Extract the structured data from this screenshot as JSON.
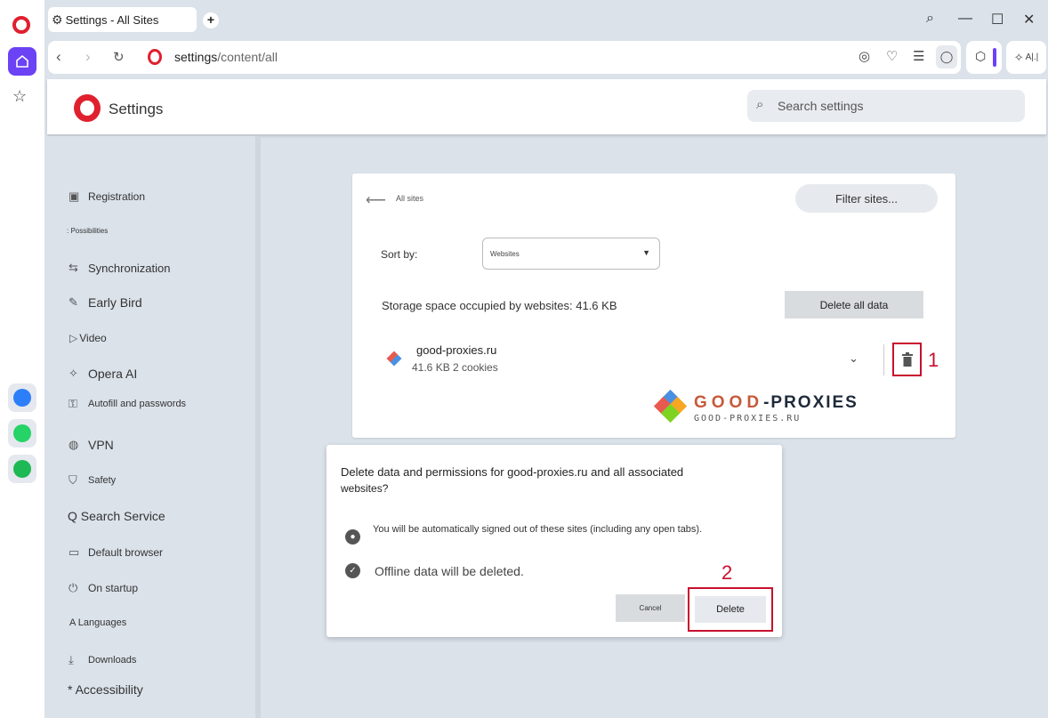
{
  "window": {
    "tab_title": "Settings - All Sites",
    "new_tab_label": "+",
    "controls": {
      "search_glyph": "⌕",
      "minimize_glyph": "—",
      "maximize_glyph": "☐",
      "close_glyph": "✕"
    }
  },
  "address_bar": {
    "url_host": "settings",
    "url_path": "/content/all",
    "ai_label": "A|.|"
  },
  "header": {
    "title": "Settings",
    "search_placeholder": "Search settings"
  },
  "sidebar_nav": [
    {
      "id": "registration",
      "label": "Registration",
      "icon": "image-icon"
    },
    {
      "id": "possibilities",
      "label": ": Possibilities",
      "icon": ""
    },
    {
      "id": "synchronization",
      "label": "Synchronization",
      "icon": "sync-icon"
    },
    {
      "id": "early-bird",
      "label": "Early Bird",
      "icon": "bird-icon"
    },
    {
      "id": "video",
      "label": "Video",
      "icon": "play-icon"
    },
    {
      "id": "opera-ai",
      "label": "Opera AI",
      "icon": "sparkle-icon"
    },
    {
      "id": "autofill",
      "label": "Autofill and passwords",
      "icon": "key-icon"
    },
    {
      "id": "vpn",
      "label": "VPN",
      "icon": "globe-icon"
    },
    {
      "id": "safety",
      "label": "Safety",
      "icon": "shield-icon"
    },
    {
      "id": "search-service",
      "label": "Q Search Service",
      "icon": ""
    },
    {
      "id": "default-browser",
      "label": "Default browser",
      "icon": "browser-icon"
    },
    {
      "id": "on-startup",
      "label": "On startup",
      "icon": "power-icon"
    },
    {
      "id": "languages",
      "label": "A Languages",
      "icon": ""
    },
    {
      "id": "downloads",
      "label": "Downloads",
      "icon": "download-icon"
    },
    {
      "id": "accessibility",
      "label": "* Accessibility",
      "icon": ""
    }
  ],
  "all_sites": {
    "back_label": "All sites",
    "filter_button": "Filter sites...",
    "sort_label": "Sort by:",
    "sort_value": "Websites",
    "storage_text": "Storage space occupied by websites: 41.6 KB",
    "delete_all_button": "Delete all data",
    "site": {
      "name": "good-proxies.ru",
      "meta": "41.6 KB 2 cookies"
    },
    "annotation_1": "1"
  },
  "watermark": {
    "brand_a": "GOOD",
    "brand_b": "-PROXIES",
    "domain": "GOOD-PROXIES.RU"
  },
  "dialog": {
    "title_line1": "Delete data and permissions for good-proxies.ru and all associated",
    "title_line2": "websites?",
    "info_signed_out": "You will be automatically signed out of these sites (including any open tabs).",
    "info_offline": "Offline data will be deleted.",
    "cancel_button": "Cancel",
    "delete_button": "Delete",
    "annotation_2": "2"
  },
  "colors": {
    "opera_red": "#e0202e",
    "accent_purple": "#6b42f4",
    "annotation_red": "#c8102e"
  }
}
